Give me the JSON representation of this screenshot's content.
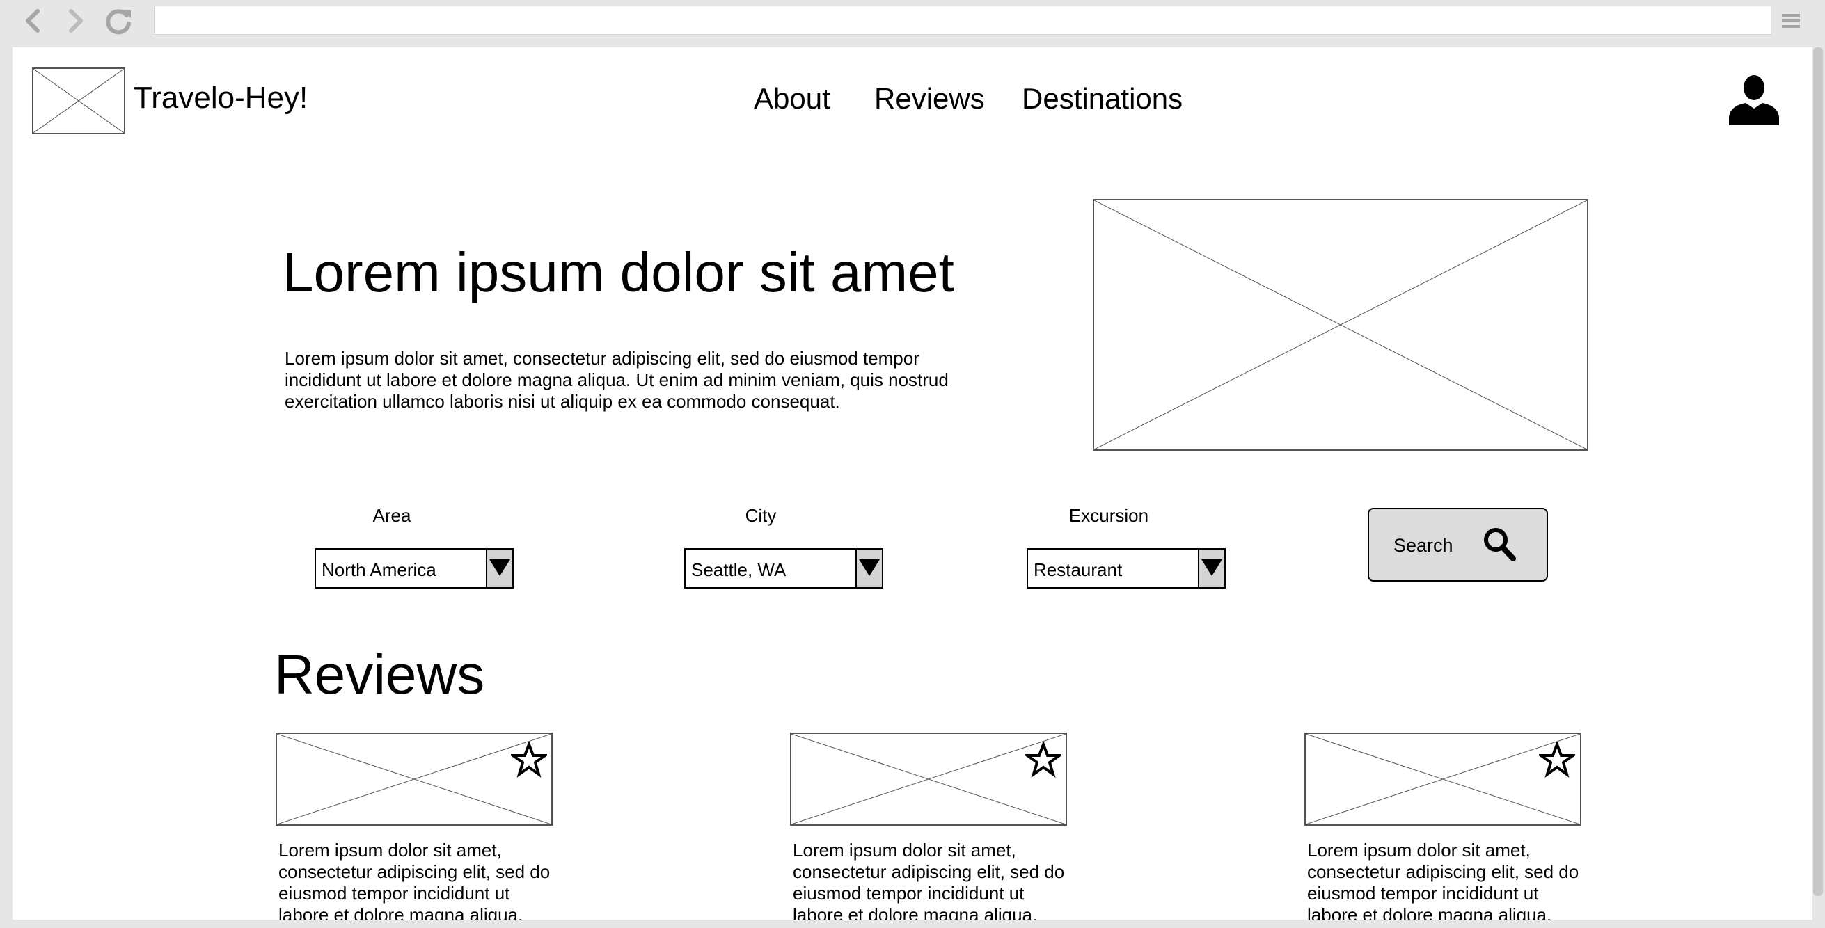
{
  "browser": {
    "back_icon": "chevron-left-icon",
    "forward_icon": "chevron-right-icon",
    "reload_icon": "reload-icon",
    "menu_icon": "hamburger-menu-icon",
    "url": ""
  },
  "header": {
    "logo": "image-placeholder",
    "brand": "Travelo-Hey!",
    "nav": [
      "About",
      "Reviews",
      "Destinations"
    ],
    "user_icon": "user-icon"
  },
  "hero": {
    "title": "Lorem ipsum dolor sit amet",
    "text": "Lorem ipsum dolor sit amet, consectetur adipiscing elit, sed do eiusmod tempor incididunt ut labore et dolore magna aliqua. Ut enim ad minim veniam, quis nostrud exercitation ullamco laboris nisi ut aliquip ex ea commodo consequat.",
    "image": "image-placeholder"
  },
  "filters": {
    "area": {
      "label": "Area",
      "value": "North America"
    },
    "city": {
      "label": "City",
      "value": "Seattle, WA"
    },
    "excursion": {
      "label": "Excursion",
      "value": "Restaurant"
    },
    "search_label": "Search",
    "search_icon": "magnifier-icon"
  },
  "reviews": {
    "title": "Reviews",
    "cards": [
      {
        "text": "Lorem ipsum dolor sit amet, consectetur adipiscing elit, sed do eiusmod tempor incididunt ut labore et dolore magna aliqua.",
        "icon": "star-icon"
      },
      {
        "text": "Lorem ipsum dolor sit amet, consectetur adipiscing elit, sed do eiusmod tempor incididunt ut labore et dolore magna aliqua.",
        "icon": "star-icon"
      },
      {
        "text": "Lorem ipsum dolor sit amet, consectetur adipiscing elit, sed do eiusmod tempor incididunt ut labore et dolore magna aliqua.",
        "icon": "star-icon"
      }
    ]
  },
  "colors": {
    "chrome": "#e6e6e6",
    "page": "#ffffff",
    "button": "#dcdcdc",
    "text": "#000000"
  }
}
